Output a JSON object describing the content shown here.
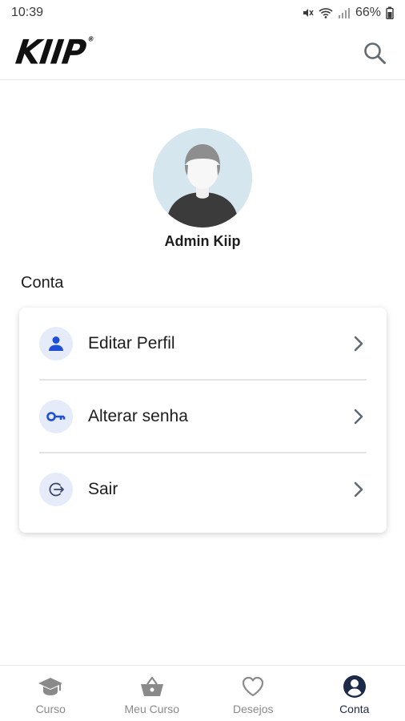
{
  "status_bar": {
    "time": "10:39",
    "battery": "66%"
  },
  "header": {
    "logo_text": "KIIP",
    "logo_mark": "®",
    "search_icon": "search-icon"
  },
  "profile": {
    "name": "Admin Kiip"
  },
  "section": {
    "title": "Conta"
  },
  "menu": {
    "items": [
      {
        "label": "Editar Perfil",
        "icon": "person-icon"
      },
      {
        "label": "Alterar senha",
        "icon": "key-icon"
      },
      {
        "label": "Sair",
        "icon": "logout-icon"
      }
    ]
  },
  "bottom_nav": {
    "items": [
      {
        "label": "Curso",
        "icon": "graduation-cap-icon",
        "active": false
      },
      {
        "label": "Meu Curso",
        "icon": "basket-icon",
        "active": false
      },
      {
        "label": "Desejos",
        "icon": "heart-icon",
        "active": false
      },
      {
        "label": "Conta",
        "icon": "account-circle-icon",
        "active": true
      }
    ]
  },
  "colors": {
    "accent": "#1e4fd6",
    "icon_bg": "#e6ebf9",
    "nav_active": "#1d2a47",
    "nav_inactive": "#8a8a8a"
  }
}
